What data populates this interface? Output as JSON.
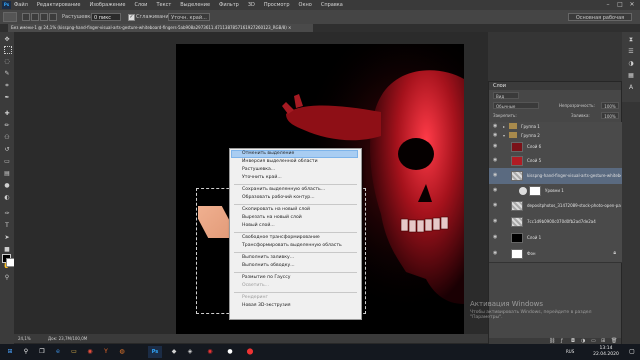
{
  "menu": {
    "items": [
      "Файл",
      "Редактирование",
      "Изображение",
      "Слои",
      "Текст",
      "Выделение",
      "Фильтр",
      "3D",
      "Просмотр",
      "Окно",
      "Справка"
    ]
  },
  "options_bar": {
    "feather_label": "Растушевка:",
    "feather_value": "0 пикс",
    "antialias_label": "Сглаживание",
    "refine_button": "Уточн. край...",
    "workspace": "Основная рабочая среда"
  },
  "document": {
    "tab_title": "Без имени-1 @ 24,1% (kisspng-hand-finger-visual-arts-gesture-whiteboard-fingers-5ab908a2973611.4711387857161927260123_RGB/8) ×"
  },
  "status": {
    "zoom": "24,1%",
    "doc_info": "Док: 23,7M/100,0M"
  },
  "layers_panel": {
    "title": "Слои",
    "filter": "Вид",
    "blend_mode": "Обычные",
    "opacity_label": "Непрозрачность:",
    "opacity_value": "100%",
    "lock_label": "Закрепить:",
    "fill_label": "Заливка:",
    "fill_value": "100%",
    "layers": [
      {
        "name": "Группа 1",
        "selected": false
      },
      {
        "name": "Группа 2",
        "selected": false
      },
      {
        "name": "Слой 6",
        "selected": false
      },
      {
        "name": "Слой 5",
        "selected": false
      },
      {
        "name": "kisspng-hand-finger-visual-arts-gesture-whiteboard-...",
        "selected": true
      },
      {
        "name": "Уровни 1",
        "selected": false
      },
      {
        "name": "depositphotos_31472089-stock-photo-open-pa...",
        "selected": false
      },
      {
        "name": "7cc1d9b0900c070d0fb2ad7de2a4",
        "selected": false
      },
      {
        "name": "Слой 1",
        "selected": false
      },
      {
        "name": "Фон",
        "selected": false
      }
    ]
  },
  "context_menu": {
    "items": [
      {
        "label": "Отменить выделение",
        "disabled": false,
        "highlighted": true
      },
      {
        "label": "Инверсия выделенной области",
        "disabled": false
      },
      {
        "label": "Растушевка...",
        "disabled": false
      },
      {
        "label": "Уточнить край...",
        "disabled": false
      },
      {
        "label": "Сохранить выделенную область...",
        "disabled": false
      },
      {
        "label": "Образовать рабочий контур...",
        "disabled": false
      },
      {
        "label": "Скопировать на новый слой",
        "disabled": false
      },
      {
        "label": "Вырезать на новый слой",
        "disabled": false
      },
      {
        "label": "Новый слой...",
        "disabled": false
      },
      {
        "label": "Свободное трансформирование",
        "disabled": false
      },
      {
        "label": "Трансформировать выделенную область",
        "disabled": false
      },
      {
        "label": "Выполнить заливку...",
        "disabled": false
      },
      {
        "label": "Выполнить обводку...",
        "disabled": false
      },
      {
        "label": "Размытие по Гауссу",
        "disabled": false
      },
      {
        "label": "Осветить...",
        "disabled": true
      },
      {
        "label": "Рендеринг",
        "disabled": true
      },
      {
        "label": "Новая 3D-экструзия",
        "disabled": false
      }
    ]
  },
  "watermark": {
    "title": "Активация Windows",
    "line1": "Чтобы активировать Windows, перейдите в раздел",
    "line2": "\"Параметры\"."
  },
  "taskbar": {
    "time": "13:14",
    "date": "22.04.2020",
    "lang": "RUS"
  }
}
